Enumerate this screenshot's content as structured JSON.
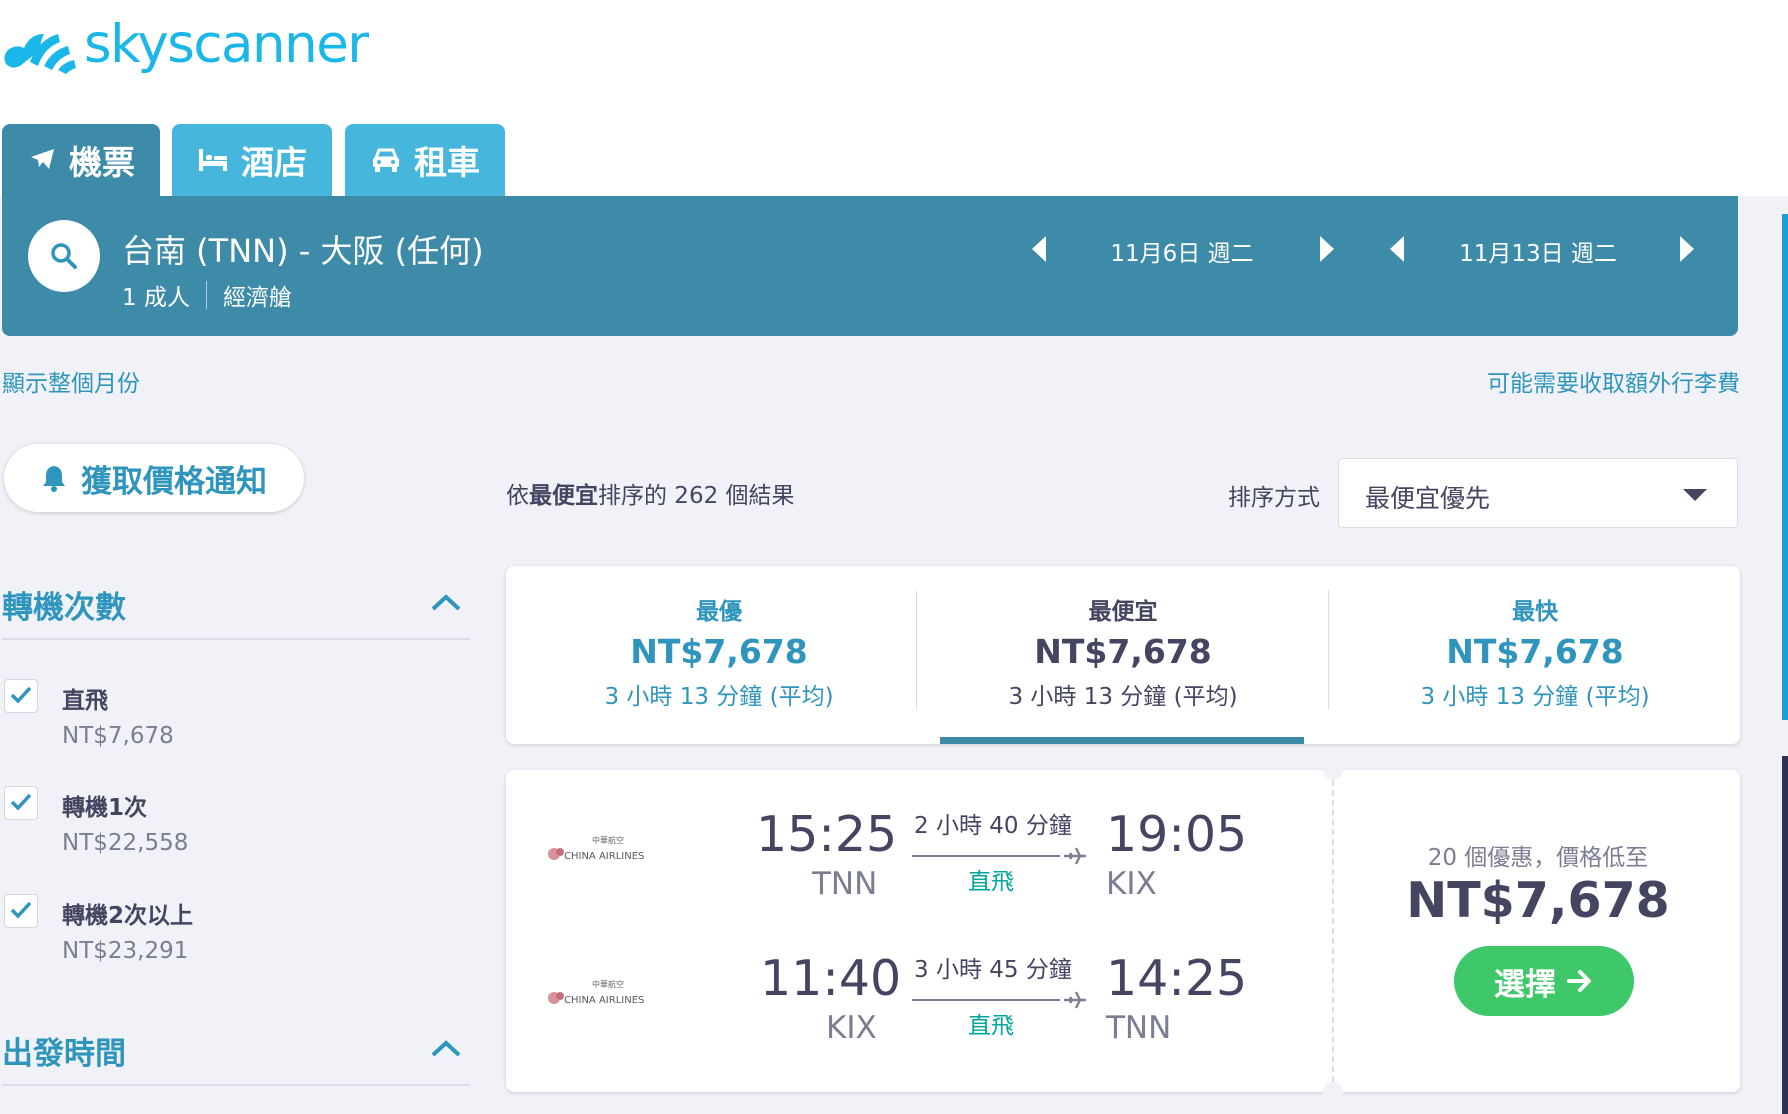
{
  "brand": {
    "name": "skyscanner",
    "color": "#1bb7e8"
  },
  "tabs": [
    {
      "label": "機票",
      "icon": "plane-icon",
      "active": true
    },
    {
      "label": "酒店",
      "icon": "bed-icon",
      "active": false
    },
    {
      "label": "租車",
      "icon": "car-icon",
      "active": false
    }
  ],
  "search": {
    "route": "台南 (TNN) - 大阪 (任何)",
    "passengers": "1 成人",
    "cabin": "經濟艙",
    "depart_date": "11月6日 週二",
    "return_date": "11月13日 週二"
  },
  "links": {
    "show_month": "顯示整個月份",
    "baggage_fee": "可能需要收取額外行李費"
  },
  "price_alert": {
    "label": "獲取價格通知"
  },
  "filters": {
    "stops": {
      "title": "轉機次數",
      "options": [
        {
          "label": "直飛",
          "price": "NT$7,678",
          "checked": true
        },
        {
          "label": "轉機1次",
          "price": "NT$22,558",
          "checked": true
        },
        {
          "label": "轉機2次以上",
          "price": "NT$23,291",
          "checked": true
        }
      ]
    },
    "departure_time": {
      "title": "出發時間"
    }
  },
  "results": {
    "summary_prefix": "依",
    "summary_bold": "最便宜",
    "summary_suffix": "排序的 262 個結果",
    "sort_label": "排序方式",
    "sort_value": "最便宜優先"
  },
  "sort_cards": [
    {
      "label": "最優",
      "price": "NT$7,678",
      "duration": "3 小時 13 分鐘 (平均)",
      "selected": false
    },
    {
      "label": "最便宜",
      "price": "NT$7,678",
      "duration": "3 小時 13 分鐘 (平均)",
      "selected": true
    },
    {
      "label": "最快",
      "price": "NT$7,678",
      "duration": "3 小時 13 分鐘 (平均)",
      "selected": false
    }
  ],
  "ticket": {
    "airline_logo_text": "CHINA AIRLINES",
    "airline_logo_cn": "中華航空",
    "legs": [
      {
        "dep_time": "15:25",
        "dep_code": "TNN",
        "duration": "2 小時 40 分鐘",
        "stops": "直飛",
        "arr_time": "19:05",
        "arr_code": "KIX"
      },
      {
        "dep_time": "11:40",
        "dep_code": "KIX",
        "duration": "3 小時 45 分鐘",
        "stops": "直飛",
        "arr_time": "14:25",
        "arr_code": "TNN"
      }
    ],
    "offers": "20 個優惠，價格低至",
    "price": "NT$7,678",
    "select_label": "選擇"
  },
  "colors": {
    "tab_active": "#3d8ba8",
    "tab_inactive": "#47b6dd",
    "link": "#2f95bd",
    "direct": "#00a698",
    "select_button": "#3fc86a"
  }
}
